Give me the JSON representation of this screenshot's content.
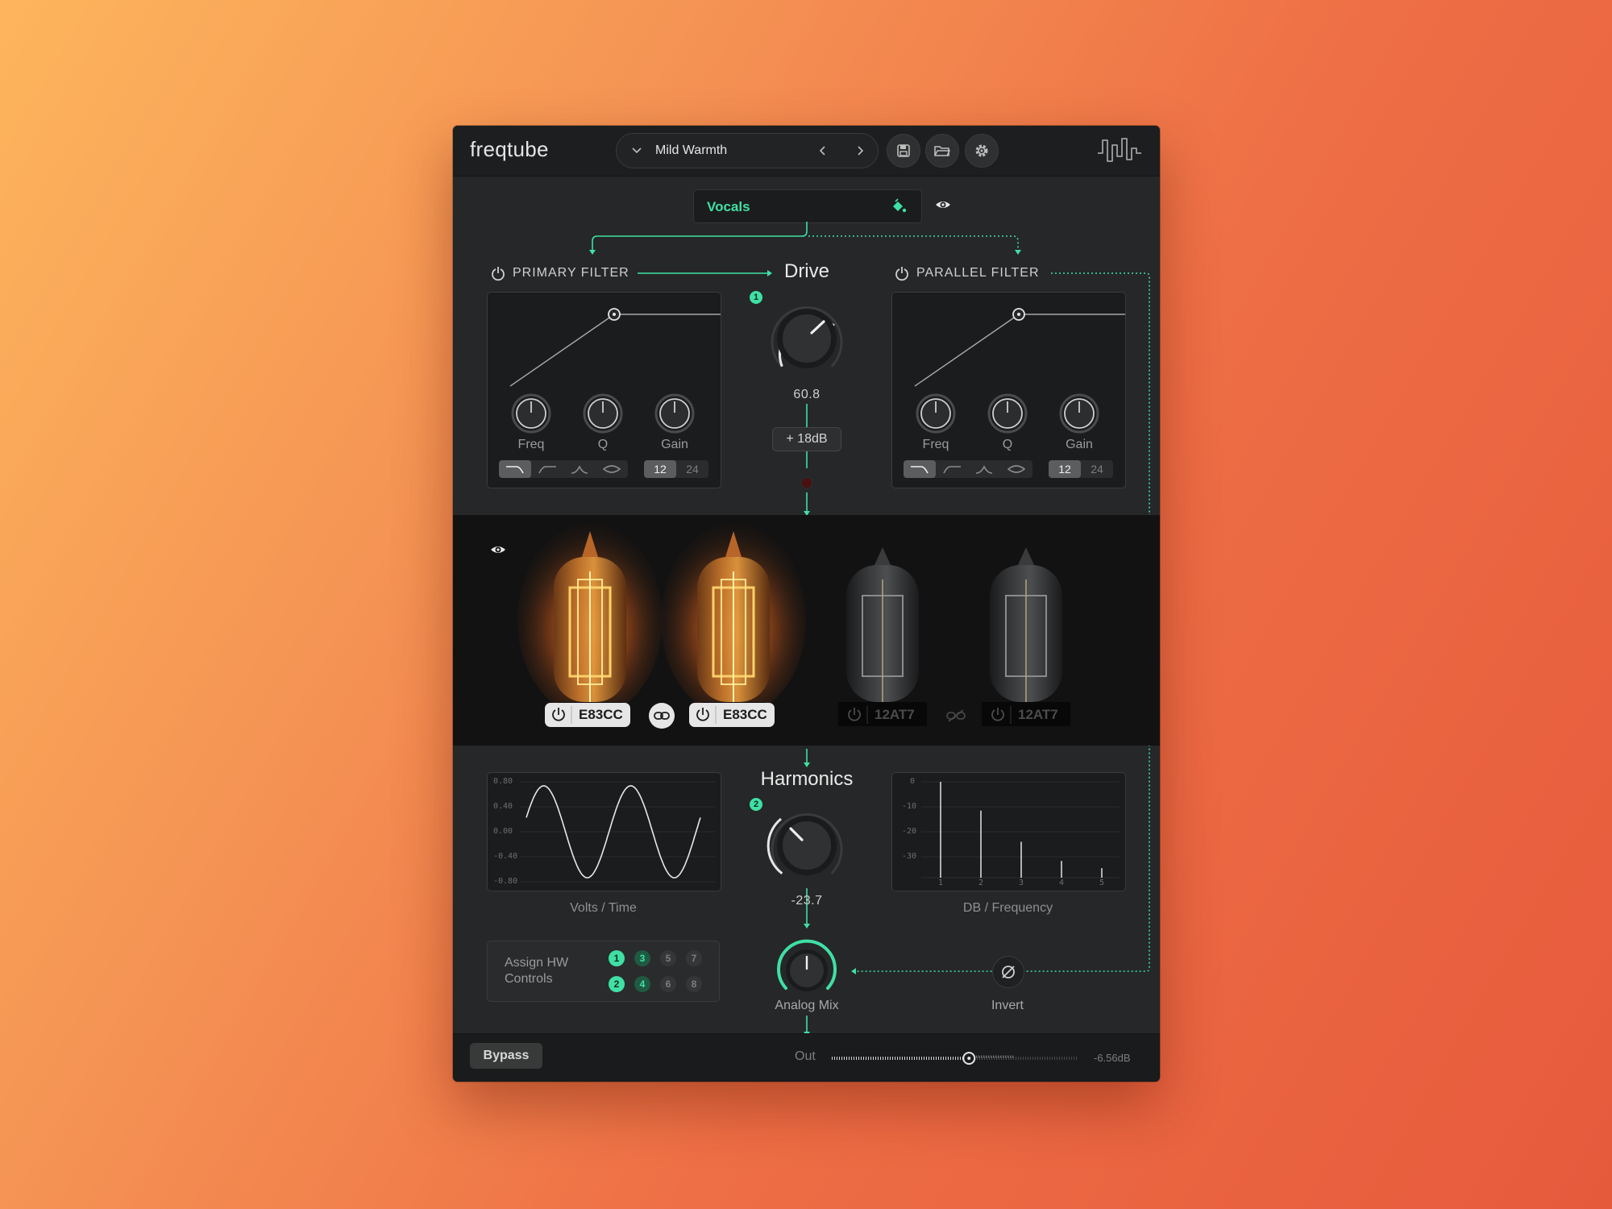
{
  "app": {
    "name": "freqtube"
  },
  "header": {
    "preset_name": "Mild Warmth"
  },
  "source": {
    "label": "Vocals",
    "accent": "#3fe0a4"
  },
  "primary_filter": {
    "title": "PRIMARY FILTER",
    "knobs": [
      "Freq",
      "Q",
      "Gain"
    ],
    "slopes": [
      "12",
      "24"
    ],
    "shape_icons": [
      "lowpass-icon",
      "highpass-icon",
      "bandpass-icon",
      "notch-icon"
    ]
  },
  "parallel_filter": {
    "title": "PARALLEL FILTER",
    "knobs": [
      "Freq",
      "Q",
      "Gain"
    ],
    "slopes": [
      "12",
      "24"
    ]
  },
  "drive": {
    "title": "Drive",
    "value": "60.8",
    "badge": "1",
    "boost": "+ 18dB"
  },
  "tubes": [
    {
      "model": "E83CC",
      "active": true
    },
    {
      "model": "E83CC",
      "active": true
    },
    {
      "model": "12AT7",
      "active": false
    },
    {
      "model": "12AT7",
      "active": false
    }
  ],
  "harmonics": {
    "title": "Harmonics",
    "value": "-23.7",
    "badge": "2"
  },
  "wave_graph": {
    "caption": "Volts / Time",
    "y_ticks": [
      "0.80",
      "0.40",
      "0.00",
      "-0.40",
      "-0.80"
    ]
  },
  "spectrum_graph": {
    "caption": "DB / Frequency",
    "y_ticks": [
      "0",
      "-10",
      "-20",
      "-30"
    ],
    "x_ticks": [
      "1",
      "2",
      "3",
      "4",
      "5"
    ],
    "levels_db": [
      0,
      -12,
      -25,
      -33,
      -36
    ]
  },
  "hw_controls": {
    "label_line1": "Assign HW",
    "label_line2": "Controls",
    "slots": [
      "1",
      "3",
      "5",
      "7",
      "2",
      "4",
      "6",
      "8"
    ]
  },
  "analog_mix": {
    "label": "Analog Mix"
  },
  "invert": {
    "label": "Invert"
  },
  "footer": {
    "bypass": "Bypass",
    "out_label": "Out",
    "out_value": "-6.56dB",
    "out_level": 0.56
  }
}
